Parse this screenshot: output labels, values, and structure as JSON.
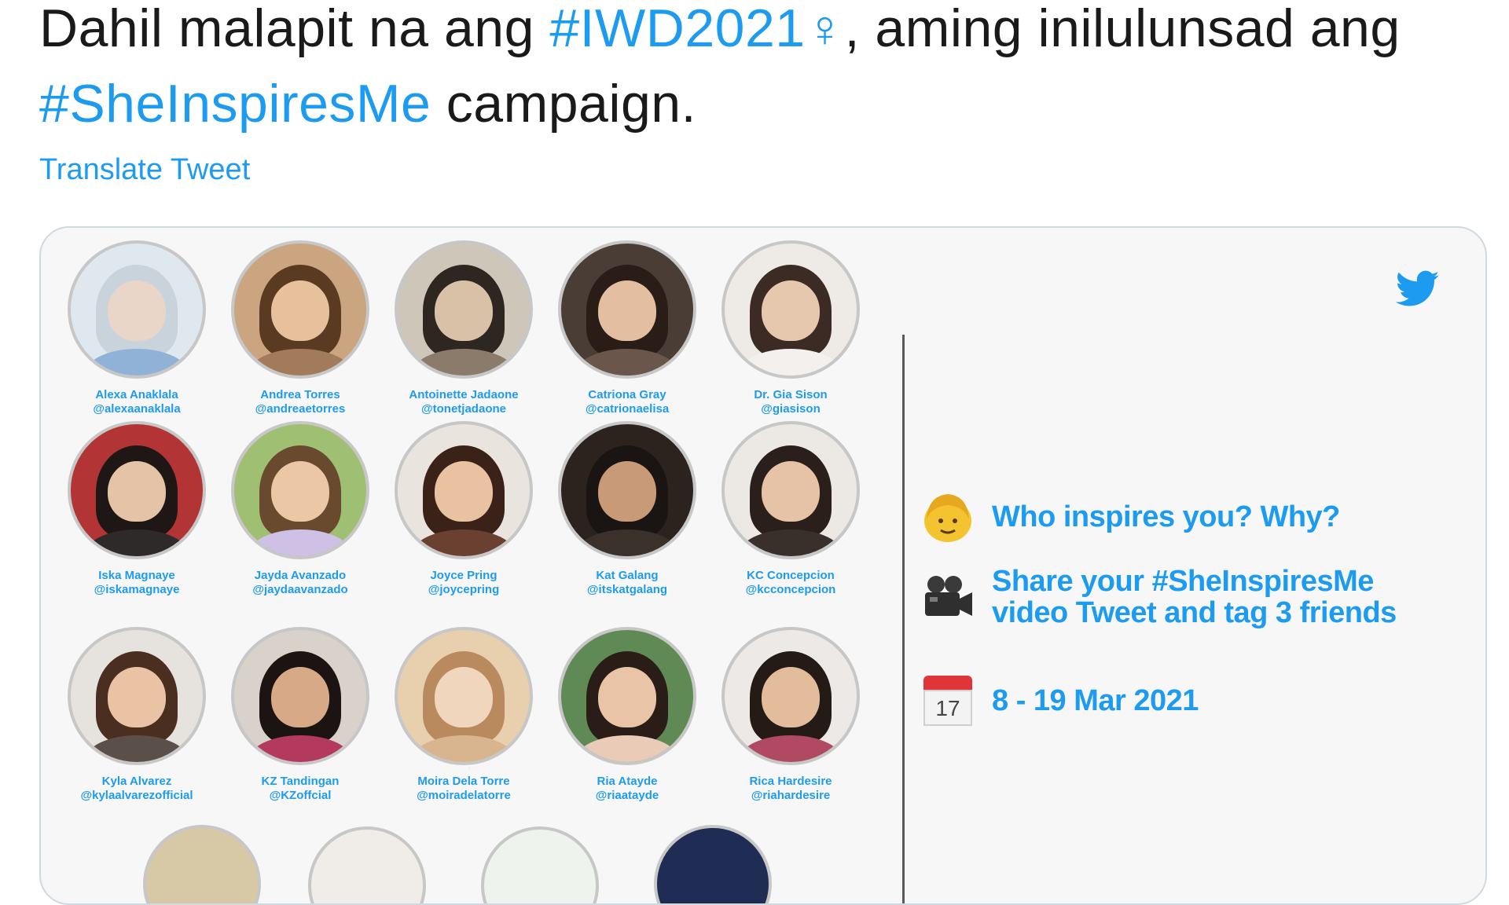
{
  "tweet": {
    "text_part1": "Dahil malapit na ang ",
    "hashtag_iwd": "#IWD2021",
    "venus_symbol": "♀",
    "text_part2": ", aming inilulunsad ang ",
    "hashtag_she": "#SheInspiresMe",
    "text_part3": " campaign.",
    "translate_label": "Translate Tweet"
  },
  "card": {
    "people": [
      {
        "name": "Alexa Anaklala",
        "handle": "@alexaanaklala",
        "bg": "#dfe7ef",
        "hair": "#c9d3dc",
        "skin": "#e9d6c8",
        "shirt": "#8fb2d6"
      },
      {
        "name": "Andrea Torres",
        "handle": "@andreaetorres",
        "bg": "#caa57f",
        "hair": "#5b3a22",
        "skin": "#e7c09c",
        "shirt": "#a27c5a"
      },
      {
        "name": "Antoinette Jadaone",
        "handle": "@tonetjadaone",
        "bg": "#cfc6ba",
        "hair": "#2e2620",
        "skin": "#d9c1a7",
        "shirt": "#8a7b6a"
      },
      {
        "name": "Catriona Gray",
        "handle": "@catrionaelisa",
        "bg": "#4a3d36",
        "hair": "#2a1d17",
        "skin": "#e3bea1",
        "shirt": "#6b564b"
      },
      {
        "name": "Dr. Gia Sison",
        "handle": "@giasison",
        "bg": "#eeeae6",
        "hair": "#3b2b24",
        "skin": "#e6c8ae",
        "shirt": "#f4f0ee"
      },
      {
        "name": "Iska Magnaye",
        "handle": "@iskamagnaye",
        "bg": "#b23434",
        "hair": "#1f1715",
        "skin": "#e4c3a7",
        "shirt": "#2e2a2a"
      },
      {
        "name": "Jayda Avanzado",
        "handle": "@jaydaavanzado",
        "bg": "#9fbf73",
        "hair": "#6a4a2e",
        "skin": "#ecc7a6",
        "shirt": "#cfc1e6"
      },
      {
        "name": "Joyce Pring",
        "handle": "@joycepring",
        "bg": "#e9e4de",
        "hair": "#3a2218",
        "skin": "#e9c2a2",
        "shirt": "#6a4030"
      },
      {
        "name": "Kat Galang",
        "handle": "@itskatgalang",
        "bg": "#2c231f",
        "hair": "#1a1412",
        "skin": "#c99a78",
        "shirt": "#3b312b"
      },
      {
        "name": "KC Concepcion",
        "handle": "@kcconcepcion",
        "bg": "#ece9e5",
        "hair": "#2a1f1a",
        "skin": "#e6c3a6",
        "shirt": "#3a302b"
      },
      {
        "name": "Kyla Alvarez",
        "handle": "@kylaalvarezofficial",
        "bg": "#e6e2de",
        "hair": "#4a2e20",
        "skin": "#e9c3a3",
        "shirt": "#5b5049"
      },
      {
        "name": "KZ Tandingan",
        "handle": "@KZoffcial",
        "bg": "#d9d2ca",
        "hair": "#1b1412",
        "skin": "#d8a986",
        "shirt": "#b33a5e"
      },
      {
        "name": "Moira Dela Torre",
        "handle": "@moiradelatorre",
        "bg": "#e8cfae",
        "hair": "#b98a5e",
        "skin": "#efd6bd",
        "shirt": "#d9b58f"
      },
      {
        "name": "Ria Atayde",
        "handle": "@riaatayde",
        "bg": "#5f8a55",
        "hair": "#2a1d17",
        "skin": "#e9c4a6",
        "shirt": "#e9cbb7"
      },
      {
        "name": "Rica Hardesire",
        "handle": "@riahardesire",
        "bg": "#ece9e6",
        "hair": "#241a16",
        "skin": "#e3bc9c",
        "shirt": "#b04a62"
      }
    ],
    "info": [
      {
        "icon": "woman-emoji-icon",
        "text": "Who inspires you? Why?"
      },
      {
        "icon": "video-camera-icon",
        "text": "Share your #SheInspiresMe video Tweet and tag 3 friends"
      },
      {
        "icon": "calendar-icon",
        "text": "8 - 19 Mar 2021",
        "calendar_day": "17"
      }
    ]
  },
  "colors": {
    "accent": "#1d9bf0",
    "text": "#1a1a1a"
  }
}
